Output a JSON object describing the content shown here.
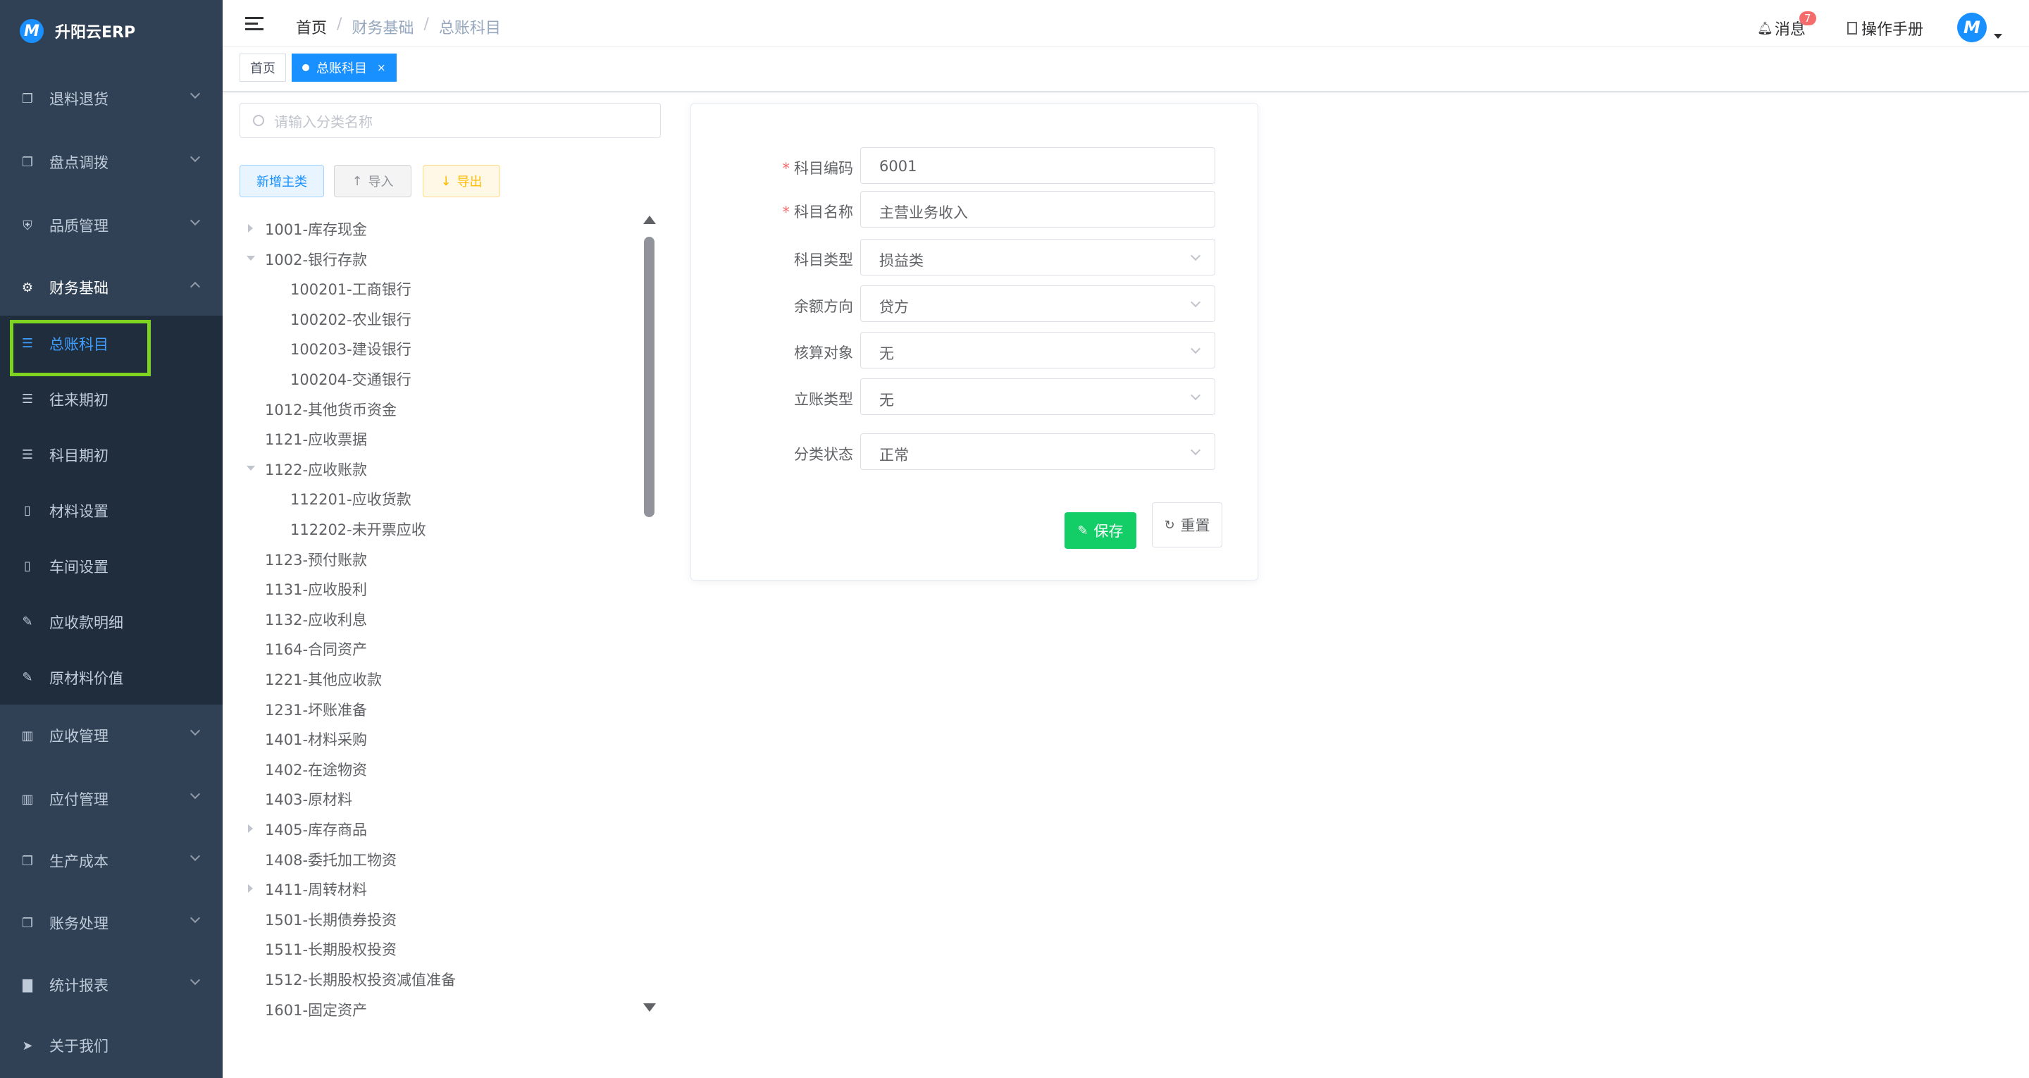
{
  "app": {
    "title": "升阳云ERP"
  },
  "sidebar": {
    "items": [
      {
        "label": "退料退货",
        "icon": "document-copy-icon",
        "top": 0
      },
      {
        "label": "盘点调拨",
        "icon": "document-copy-icon"
      },
      {
        "label": "品质管理",
        "icon": "shield-icon"
      },
      {
        "label": "财务基础",
        "icon": "gear-icon"
      },
      {
        "label": "应收管理",
        "icon": "wallet-icon"
      },
      {
        "label": "应付管理",
        "icon": "wallet-icon"
      },
      {
        "label": "生产成本",
        "icon": "document-copy-icon"
      },
      {
        "label": "账务处理",
        "icon": "document-copy-icon"
      },
      {
        "label": "统计报表",
        "icon": "bar-chart-icon"
      },
      {
        "label": "关于我们",
        "icon": "send-icon"
      }
    ],
    "sub_items": [
      {
        "label": "总账科目",
        "icon": "document-icon"
      },
      {
        "label": "往来期初",
        "icon": "document-icon"
      },
      {
        "label": "科目期初",
        "icon": "document-icon"
      },
      {
        "label": "材料设置",
        "icon": "book-icon"
      },
      {
        "label": "车间设置",
        "icon": "book-icon"
      },
      {
        "label": "应收款明细",
        "icon": "edit-icon"
      },
      {
        "label": "原材料价值",
        "icon": "edit-icon"
      }
    ]
  },
  "navbar": {
    "breadcrumb": [
      "首页",
      "财务基础",
      "总账科目"
    ],
    "messages_label": "消息",
    "messages_count": "7",
    "manual_label": "操作手册"
  },
  "tags": {
    "home": "首页",
    "active": "总账科目",
    "close": "×"
  },
  "tree_panel": {
    "search_placeholder": "请输入分类名称",
    "add_label": "新增主类",
    "import_label": "导入",
    "export_label": "导出",
    "nodes": [
      {
        "label": "1001-库存现金",
        "level": 0,
        "arrow": "right"
      },
      {
        "label": "1002-银行存款",
        "level": 0,
        "arrow": "down"
      },
      {
        "label": "100201-工商银行",
        "level": 1,
        "arrow": ""
      },
      {
        "label": "100202-农业银行",
        "level": 1,
        "arrow": ""
      },
      {
        "label": "100203-建设银行",
        "level": 1,
        "arrow": ""
      },
      {
        "label": "100204-交通银行",
        "level": 1,
        "arrow": ""
      },
      {
        "label": "1012-其他货币资金",
        "level": 0,
        "arrow": ""
      },
      {
        "label": "1121-应收票据",
        "level": 0,
        "arrow": ""
      },
      {
        "label": "1122-应收账款",
        "level": 0,
        "arrow": "down"
      },
      {
        "label": "112201-应收货款",
        "level": 1,
        "arrow": ""
      },
      {
        "label": "112202-未开票应收",
        "level": 1,
        "arrow": ""
      },
      {
        "label": "1123-预付账款",
        "level": 0,
        "arrow": ""
      },
      {
        "label": "1131-应收股利",
        "level": 0,
        "arrow": ""
      },
      {
        "label": "1132-应收利息",
        "level": 0,
        "arrow": ""
      },
      {
        "label": "1164-合同资产",
        "level": 0,
        "arrow": ""
      },
      {
        "label": "1221-其他应收款",
        "level": 0,
        "arrow": ""
      },
      {
        "label": "1231-坏账准备",
        "level": 0,
        "arrow": ""
      },
      {
        "label": "1401-材料采购",
        "level": 0,
        "arrow": ""
      },
      {
        "label": "1402-在途物资",
        "level": 0,
        "arrow": ""
      },
      {
        "label": "1403-原材料",
        "level": 0,
        "arrow": ""
      },
      {
        "label": "1405-库存商品",
        "level": 0,
        "arrow": "right"
      },
      {
        "label": "1408-委托加工物资",
        "level": 0,
        "arrow": ""
      },
      {
        "label": "1411-周转材料",
        "level": 0,
        "arrow": "right"
      },
      {
        "label": "1501-长期债券投资",
        "level": 0,
        "arrow": ""
      },
      {
        "label": "1511-长期股权投资",
        "level": 0,
        "arrow": ""
      },
      {
        "label": "1512-长期股权投资减值准备",
        "level": 0,
        "arrow": ""
      },
      {
        "label": "1601-固定资产",
        "level": 0,
        "arrow": ""
      }
    ]
  },
  "form": {
    "fields": [
      {
        "label": "科目编码",
        "value": "6001",
        "required": true,
        "type": "input"
      },
      {
        "label": "科目名称",
        "value": "主营业务收入",
        "required": true,
        "type": "input"
      },
      {
        "label": "科目类型",
        "value": "损益类",
        "required": false,
        "type": "select"
      },
      {
        "label": "余额方向",
        "value": "贷方",
        "required": false,
        "type": "select"
      },
      {
        "label": "核算对象",
        "value": "无",
        "required": false,
        "type": "select"
      },
      {
        "label": "立账类型",
        "value": "无",
        "required": false,
        "type": "select"
      },
      {
        "label": "分类状态",
        "value": "正常",
        "required": false,
        "type": "select"
      }
    ],
    "save_label": "保存",
    "reset_label": "重置"
  },
  "colors": {
    "sidebar": "#304156",
    "submenu": "#1f2d3d",
    "accent": "#1890ff",
    "save": "#13ce66",
    "highlight": "#7ed321"
  }
}
